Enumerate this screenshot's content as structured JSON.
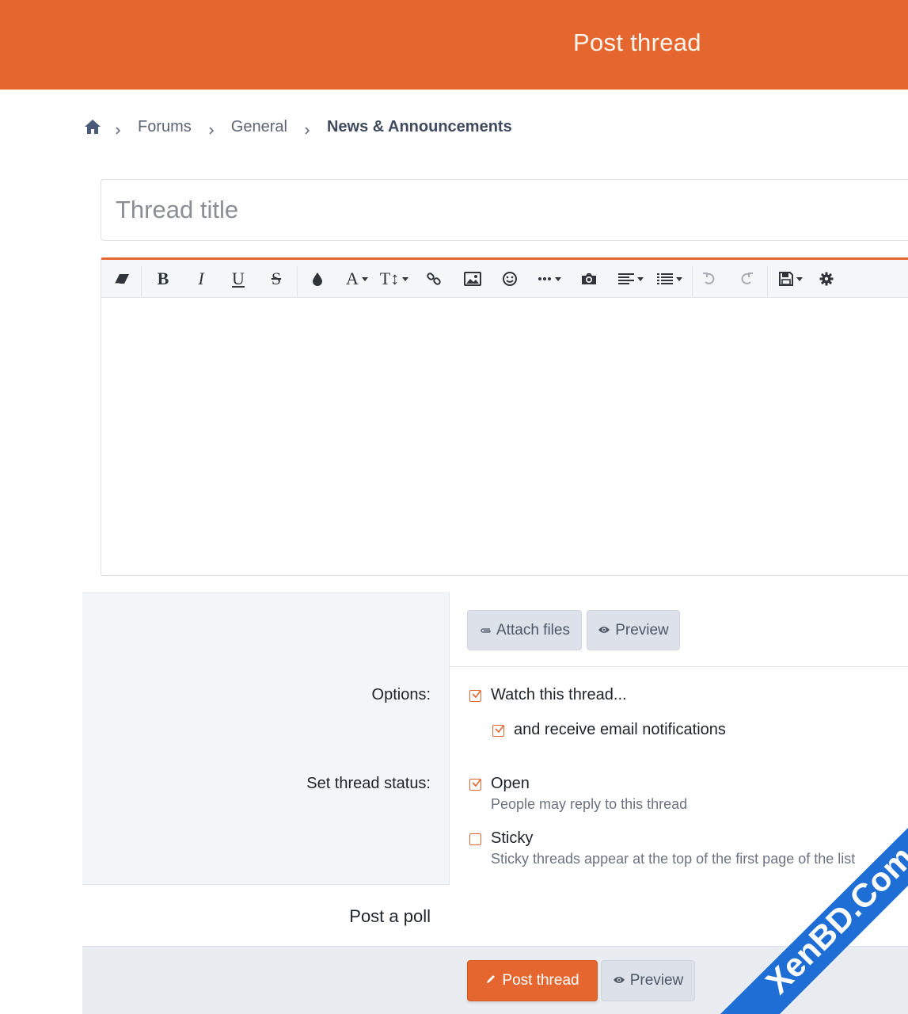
{
  "header": {
    "title": "Post thread"
  },
  "breadcrumb": {
    "home_icon": "home-icon",
    "items": [
      "Forums",
      "General",
      "News & Announcements"
    ]
  },
  "thread_title": {
    "placeholder": "Thread title",
    "value": ""
  },
  "editor": {
    "accent": "#e5672f",
    "toolbar": [
      "eraser-icon",
      "bold-icon",
      "italic-icon",
      "underline-icon",
      "strikethrough-icon",
      "color-drop-icon",
      "font-family-icon",
      "font-size-icon",
      "link-icon",
      "image-icon",
      "smiley-icon",
      "more-icon",
      "camera-icon",
      "align-icon",
      "list-icon",
      "undo-icon",
      "redo-icon",
      "save-draft-icon",
      "settings-icon"
    ],
    "body": ""
  },
  "attachments": {
    "attach_label": "Attach files",
    "preview_label": "Preview"
  },
  "options": {
    "label": "Options:",
    "watch_label": "Watch this thread...",
    "watch_checked": true,
    "email_label": "and receive email notifications",
    "email_checked": true
  },
  "status": {
    "label": "Set thread status:",
    "open_label": "Open",
    "open_hint": "People may reply to this thread",
    "open_checked": true,
    "sticky_label": "Sticky",
    "sticky_hint": "Sticky threads appear at the top of the first page of the list",
    "sticky_checked": false
  },
  "poll": {
    "label": "Post a poll"
  },
  "submit": {
    "post_label": "Post thread",
    "preview_label": "Preview"
  },
  "watermark": {
    "text": "XenBD.Com",
    "color": "#1e6ed6"
  }
}
